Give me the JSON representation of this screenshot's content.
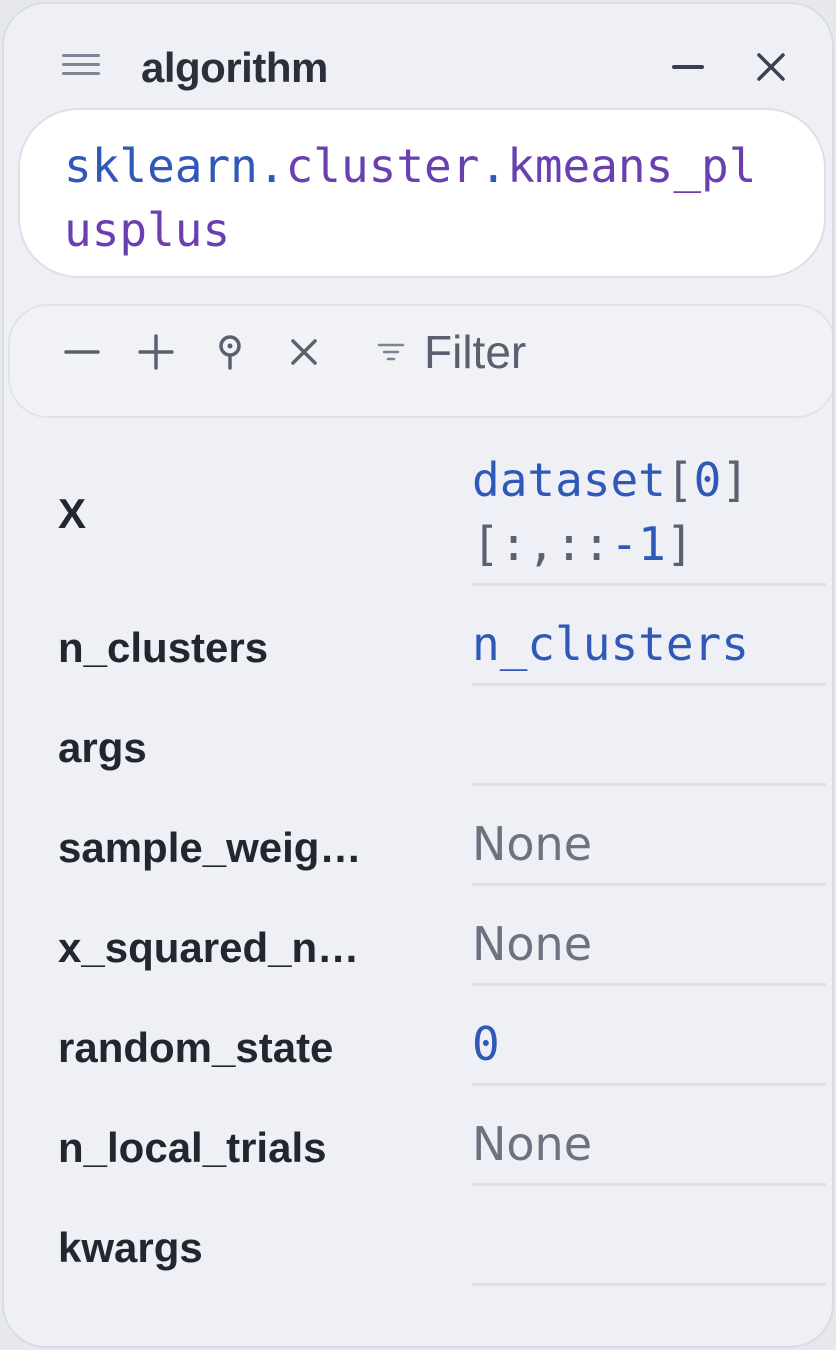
{
  "header": {
    "title": "algorithm",
    "menu_icon": "hamburger-menu-icon",
    "minimize_icon": "minimize-icon",
    "close_icon": "close-icon"
  },
  "code": {
    "module_part1": "sklearn",
    "dot1": ".",
    "module_part2": "cluster",
    "dot2": ".",
    "func": "kmeans_plusplus"
  },
  "toolbar": {
    "collapse_icon": "minus-icon",
    "expand_icon": "plus-icon",
    "pin_icon": "pin-icon",
    "clear_icon": "x-icon",
    "filter_icon": "filter-icon",
    "filter_label": "Filter"
  },
  "params": [
    {
      "name": "X",
      "value": "dataset[0][:,::-1]"
    },
    {
      "name": "n_clusters",
      "value": "n_clusters"
    },
    {
      "name": "args",
      "value": ""
    },
    {
      "name": "sample_weig…",
      "value": "None"
    },
    {
      "name": "x_squared_n…",
      "value": "None"
    },
    {
      "name": "random_state",
      "value": "0"
    },
    {
      "name": "n_local_trials",
      "value": "None"
    },
    {
      "name": "kwargs",
      "value": ""
    }
  ],
  "colors": {
    "background": "#eef0f5",
    "identifier": "#2f58b8",
    "attribute": "#6a3fb0",
    "label": "#22262f",
    "muted": "#6c7280"
  }
}
